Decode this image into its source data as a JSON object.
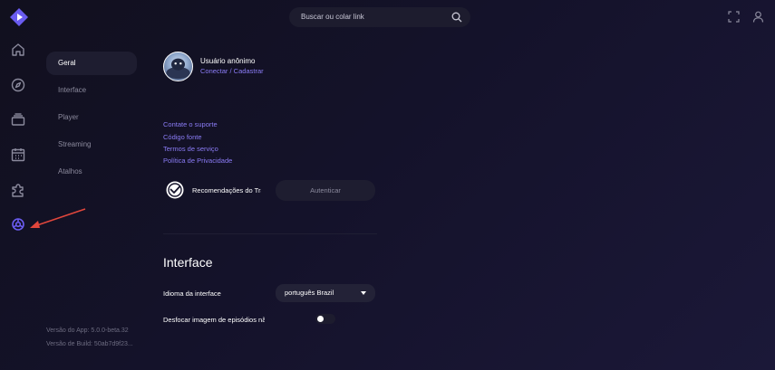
{
  "colors": {
    "accent": "#8b7cf6",
    "nav_active": "#6a5cf0",
    "icon_default": "#8b8a9d",
    "annotation_arrow": "#e0463c"
  },
  "sidebar": {
    "logo": "play-logo-icon",
    "items": [
      {
        "name": "home",
        "icon": "home-icon"
      },
      {
        "name": "discover",
        "icon": "compass-icon"
      },
      {
        "name": "library",
        "icon": "library-icon"
      },
      {
        "name": "calendar",
        "icon": "calendar-icon"
      },
      {
        "name": "addons",
        "icon": "puzzle-icon"
      },
      {
        "name": "settings",
        "icon": "gear-icon",
        "active": true
      }
    ]
  },
  "header": {
    "search_placeholder": "Buscar ou colar link",
    "search_icon": "search-icon",
    "fullscreen_icon": "fullscreen-icon",
    "profile_icon": "user-icon"
  },
  "settings_nav": {
    "tabs": [
      {
        "label": "Geral",
        "active": true
      },
      {
        "label": "Interface"
      },
      {
        "label": "Player"
      },
      {
        "label": "Streaming"
      },
      {
        "label": "Atalhos"
      }
    ],
    "app_version": "Versão do App: 5.0.0-beta.32",
    "build_version": "Versão de Build: 50ab7d9f23..."
  },
  "account": {
    "user_name": "Usuário anônimo",
    "login_link": "Conectar / Cadastrar"
  },
  "links": {
    "support": "Contate o suporte",
    "source": "Código fonte",
    "terms": "Termos de serviço",
    "privacy": "Política de Privacidade"
  },
  "trakt": {
    "label": "Recomendações do Trakt",
    "button": "Autenticar"
  },
  "interface": {
    "title": "Interface",
    "language_label": "Idioma da interface",
    "language_value": "português Brazil",
    "blur_label": "Desfocar imagem de episódios não assistidos",
    "blur_enabled": false
  }
}
